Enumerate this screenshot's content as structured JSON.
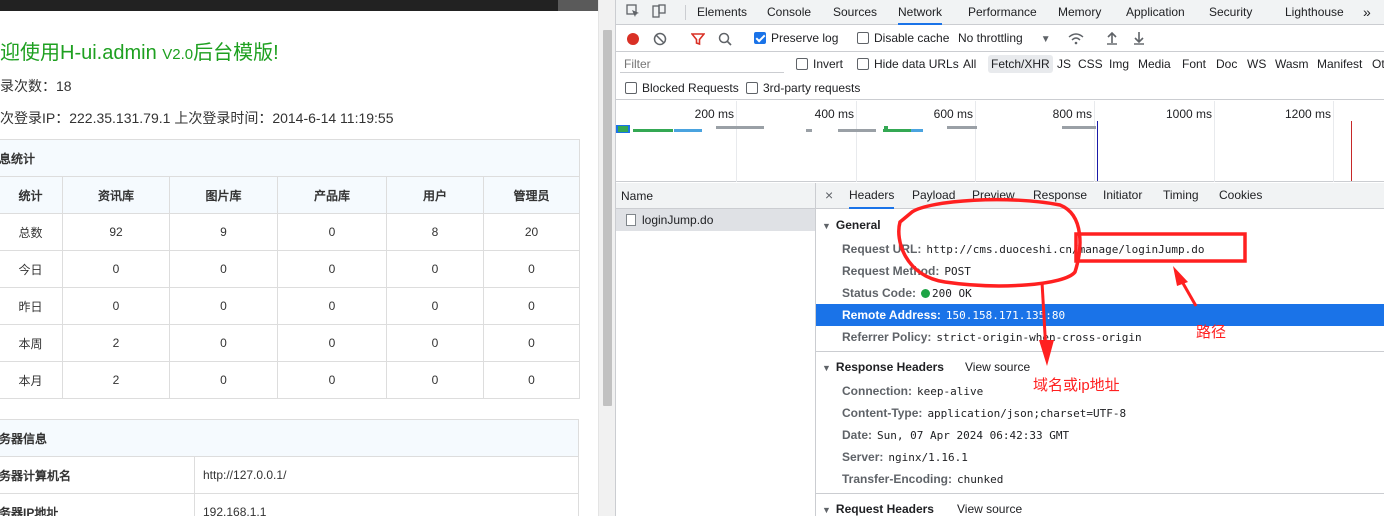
{
  "page": {
    "welcome_title": "迎使用H-ui.admin ",
    "welcome_version": "V2.0",
    "welcome_suffix": "后台模版!",
    "login_count": "录次数：18",
    "login_ip": "次登录IP：222.35.131.79.1  上次登录时间：2014-6-14 11:19:55",
    "stats_caption": "息统计",
    "stats_headers": [
      "统计",
      "资讯库",
      "图片库",
      "产品库",
      "用户",
      "管理员"
    ],
    "stats_rows": [
      [
        "总数",
        "92",
        "9",
        "0",
        "8",
        "20"
      ],
      [
        "今日",
        "0",
        "0",
        "0",
        "0",
        "0"
      ],
      [
        "昨日",
        "0",
        "0",
        "0",
        "0",
        "0"
      ],
      [
        "本周",
        "2",
        "0",
        "0",
        "0",
        "0"
      ],
      [
        "本月",
        "2",
        "0",
        "0",
        "0",
        "0"
      ]
    ],
    "server_caption": "务器信息",
    "server_rows": [
      [
        "务器计算机名",
        "http://127.0.0.1/"
      ],
      [
        "务器IP地址",
        "192.168.1.1"
      ]
    ]
  },
  "devtools": {
    "tabs": [
      "Elements",
      "Console",
      "Sources",
      "Network",
      "Performance",
      "Memory",
      "Application",
      "Security",
      "Lighthouse"
    ],
    "active_tab": "Network",
    "more_tabs": "»",
    "preserve_log": "Preserve log",
    "disable_cache": "Disable cache",
    "throttling": "No throttling",
    "filter_placeholder": "Filter",
    "invert": "Invert",
    "hide_data_urls": "Hide data URLs",
    "types": [
      "All",
      "Fetch/XHR",
      "JS",
      "CSS",
      "Img",
      "Media",
      "Font",
      "Doc",
      "WS",
      "Wasm",
      "Manifest",
      "Ot"
    ],
    "active_type": "Fetch/XHR",
    "blocked_requests": "Blocked Requests",
    "third_party": "3rd-party requests",
    "timeline_labels": [
      "200 ms",
      "400 ms",
      "600 ms",
      "800 ms",
      "1000 ms",
      "1200 ms"
    ],
    "list_header": "Name",
    "requests": [
      "loginJump.do"
    ],
    "detail_tabs": [
      "Headers",
      "Payload",
      "Preview",
      "Response",
      "Initiator",
      "Timing",
      "Cookies"
    ],
    "active_detail_tab": "Headers",
    "general": {
      "title": "General",
      "request_url_key": "Request URL:",
      "request_url": "http://cms.duoceshi.cn/manage/loginJump.do",
      "request_method_key": "Request Method:",
      "request_method": "POST",
      "status_code_key": "Status Code:",
      "status_code": "200 OK",
      "remote_address_key": "Remote Address:",
      "remote_address": "150.158.171.135:80",
      "referrer_policy_key": "Referrer Policy:",
      "referrer_policy": "strict-origin-when-cross-origin"
    },
    "response_headers": {
      "title": "Response Headers",
      "view_source": "View source",
      "items": [
        [
          "Connection:",
          "keep-alive"
        ],
        [
          "Content-Type:",
          "application/json;charset=UTF-8"
        ],
        [
          "Date:",
          "Sun, 07 Apr 2024 06:42:33 GMT"
        ],
        [
          "Server:",
          "nginx/1.16.1"
        ],
        [
          "Transfer-Encoding:",
          "chunked"
        ]
      ]
    },
    "request_headers": {
      "title": "Request Headers",
      "view_source": "View source"
    }
  },
  "annotations": {
    "path_label": "路径",
    "domain_label": "域名或ip地址",
    "color": "#ff2020"
  }
}
